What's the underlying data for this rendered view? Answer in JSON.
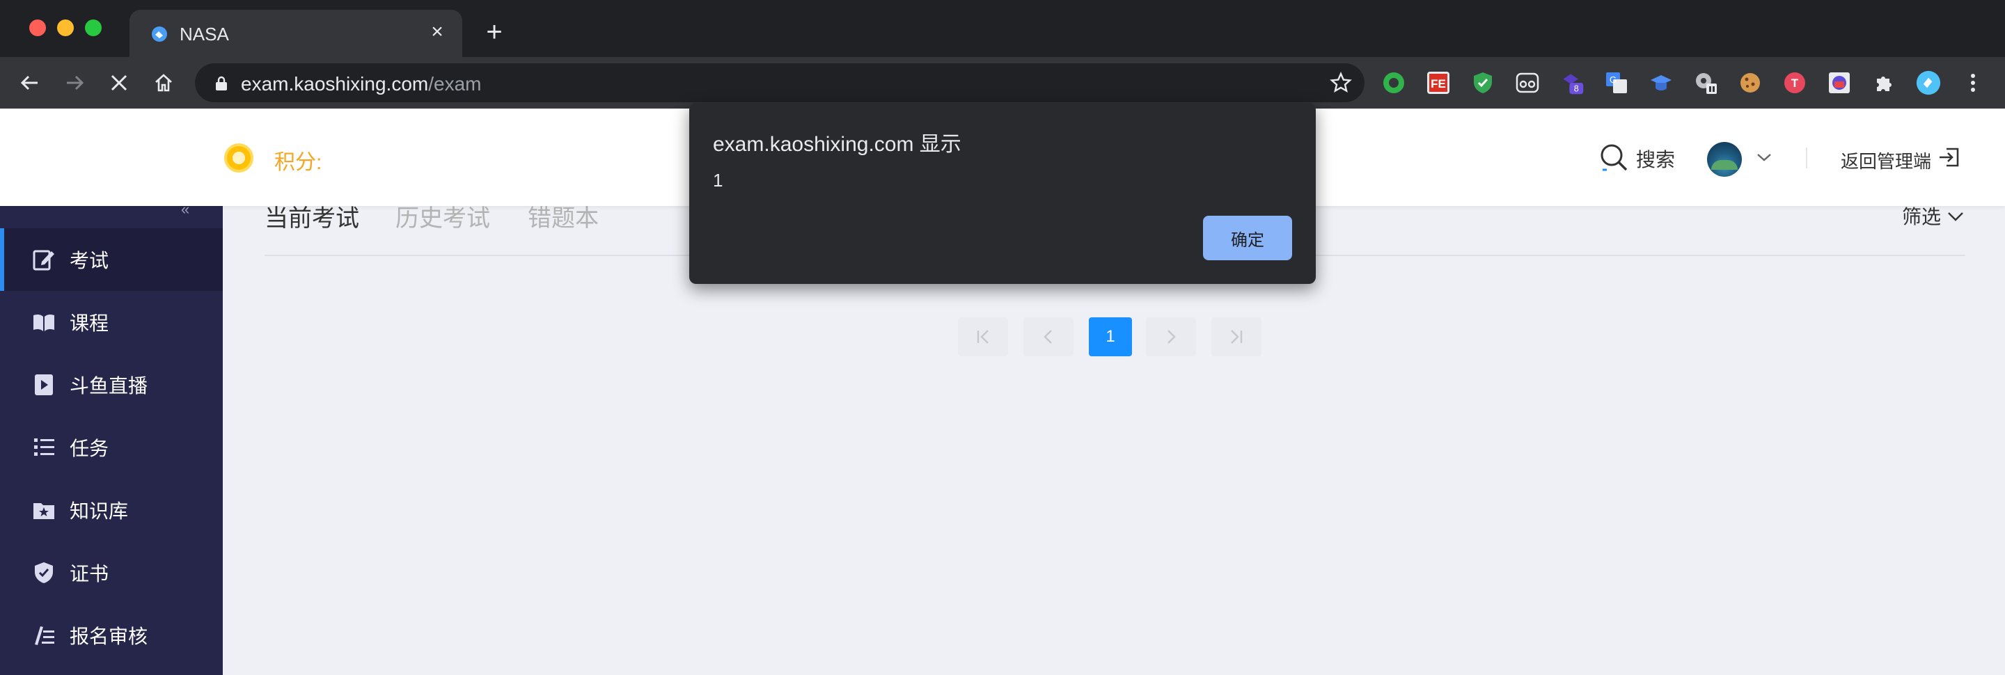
{
  "browser": {
    "tab_title": "NASA",
    "url_host": "exam.kaoshixing.com",
    "url_path": "/exam",
    "tab_close": "×",
    "new_tab": "+",
    "extensions": [
      "green-circle-extension",
      "fe-extension",
      "shield-extension",
      "owl-extension",
      "badge-8-extension",
      "translate-extension",
      "graduation-cap-extension",
      "gear-extension",
      "cookie-extension",
      "t-extension",
      "radio-extension",
      "puzzle-extension",
      "profile-extension",
      "more-menu"
    ],
    "ext_badge": "8"
  },
  "header": {
    "points_label": "积分:",
    "search_label": "搜索",
    "back_admin_label": "返回管理端"
  },
  "sidebar": {
    "collapse_glyph": "«",
    "items": [
      {
        "label": "考试",
        "icon": "edit-icon",
        "active": true
      },
      {
        "label": "课程",
        "icon": "book-icon",
        "active": false
      },
      {
        "label": "斗鱼直播",
        "icon": "play-icon",
        "active": false
      },
      {
        "label": "任务",
        "icon": "list-icon",
        "active": false
      },
      {
        "label": "知识库",
        "icon": "folder-star-icon",
        "active": false
      },
      {
        "label": "证书",
        "icon": "shield-check-icon",
        "active": false
      },
      {
        "label": "报名审核",
        "icon": "pen-lines-icon",
        "active": false
      }
    ]
  },
  "main": {
    "tabs": [
      {
        "label": "当前考试",
        "active": true
      },
      {
        "label": "历史考试",
        "active": false
      },
      {
        "label": "错题本",
        "active": false
      }
    ],
    "filter_label": "筛选",
    "pagination": {
      "current_page": "1"
    }
  },
  "alert": {
    "title": "exam.kaoshixing.com 显示",
    "message": "1",
    "ok_label": "确定"
  },
  "colors": {
    "accent": "#1890ff",
    "sidebar_bg": "#26264a",
    "points": "#f5a623",
    "alert_button": "#8ab4f8"
  }
}
